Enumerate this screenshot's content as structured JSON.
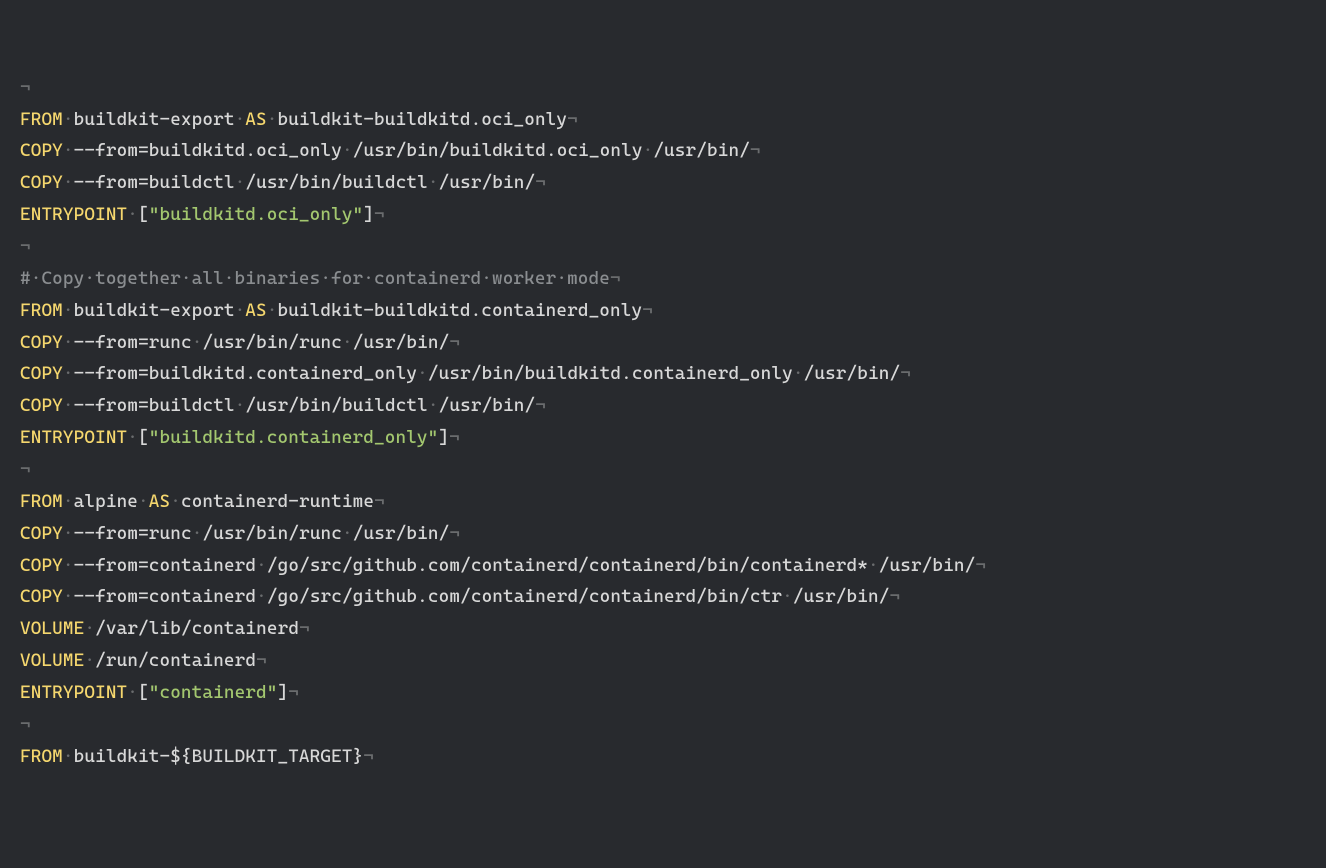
{
  "ws_dot": "·",
  "ws_nl": "¬",
  "lines": [
    {
      "type": "blank"
    },
    {
      "type": "from",
      "image": "buildkit-export",
      "alias": "buildkit-buildkitd.oci_only"
    },
    {
      "type": "copy",
      "rest": "--from=buildkitd.oci_only·/usr/bin/buildkitd.oci_only·/usr/bin/"
    },
    {
      "type": "copy",
      "rest": "--from=buildctl·/usr/bin/buildctl·/usr/bin/"
    },
    {
      "type": "entrypoint",
      "str": "\"buildkitd.oci_only\""
    },
    {
      "type": "blank"
    },
    {
      "type": "comment",
      "text": "#·Copy·together·all·binaries·for·containerd·worker·mode"
    },
    {
      "type": "from",
      "image": "buildkit-export",
      "alias": "buildkit-buildkitd.containerd_only"
    },
    {
      "type": "copy",
      "rest": "--from=runc·/usr/bin/runc·/usr/bin/"
    },
    {
      "type": "copy",
      "rest": "--from=buildkitd.containerd_only·/usr/bin/buildkitd.containerd_only·/usr/bin/"
    },
    {
      "type": "copy",
      "rest": "--from=buildctl·/usr/bin/buildctl·/usr/bin/"
    },
    {
      "type": "entrypoint",
      "str": "\"buildkitd.containerd_only\""
    },
    {
      "type": "blank"
    },
    {
      "type": "from",
      "image": "alpine",
      "alias": "containerd-runtime"
    },
    {
      "type": "copy",
      "rest": "--from=runc·/usr/bin/runc·/usr/bin/"
    },
    {
      "type": "copy",
      "rest": "--from=containerd·/go/src/github.com/containerd/containerd/bin/containerd*·/usr/bin/"
    },
    {
      "type": "copy",
      "rest": "--from=containerd·/go/src/github.com/containerd/containerd/bin/ctr·/usr/bin/"
    },
    {
      "type": "volume",
      "rest": "/var/lib/containerd"
    },
    {
      "type": "volume",
      "rest": "/run/containerd"
    },
    {
      "type": "entrypoint",
      "str": "\"containerd\""
    },
    {
      "type": "blank"
    },
    {
      "type": "from-novar",
      "image": "buildkit-${BUILDKIT_TARGET}"
    }
  ]
}
